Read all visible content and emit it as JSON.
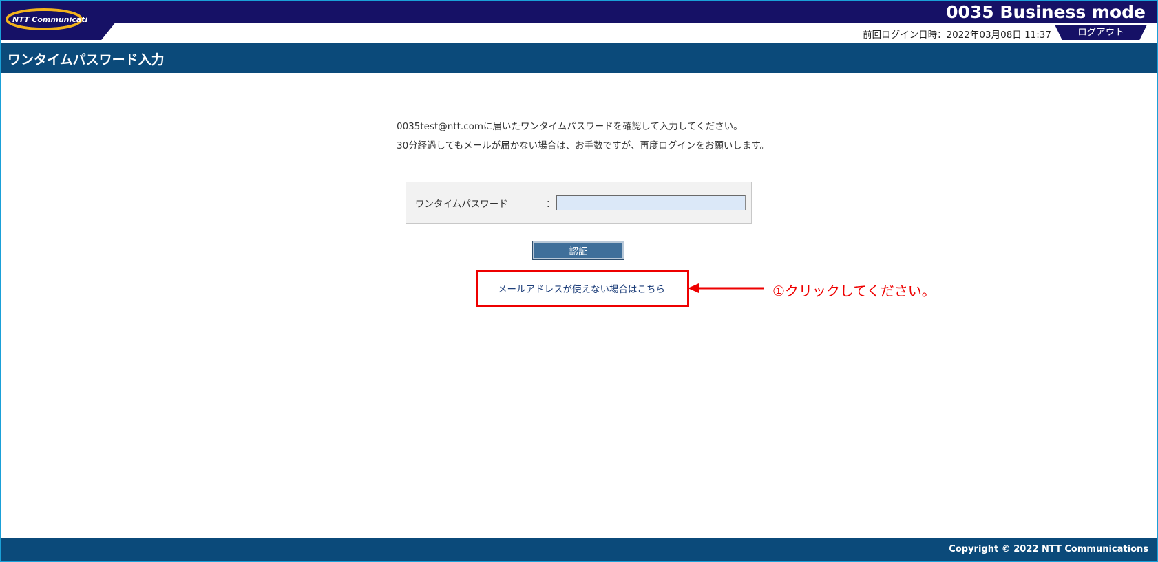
{
  "header": {
    "brand_logo_text": "NTT Communications",
    "app_title": "0035 Business mode",
    "last_login": "前回ログイン日時：2022年03月08日 11:37",
    "logout_label": "ログアウト"
  },
  "page": {
    "title": "ワンタイムパスワード入力"
  },
  "instructions": {
    "line1": "0035test@ntt.comに届いたワンタイムパスワードを確認して入力してください。",
    "line2": "30分経過してもメールが届かない場合は、お手数ですが、再度ログインをお願いします。"
  },
  "form": {
    "otp_label": "ワンタイムパスワード",
    "otp_colon": "：",
    "otp_value": "",
    "otp_placeholder": ""
  },
  "actions": {
    "auth_button_label": "認証",
    "alt_link_label": "メールアドレスが使えない場合はこちら"
  },
  "annotation": {
    "text": "①クリックしてください。",
    "color": "#ee0000"
  },
  "footer": {
    "copyright": "Copyright © 2022 NTT Communications"
  },
  "colors": {
    "header_navy": "#161166",
    "title_bar_blue": "#0b4a7a",
    "button_blue": "#3f6f9a",
    "frame_border": "#1aa0d8"
  }
}
